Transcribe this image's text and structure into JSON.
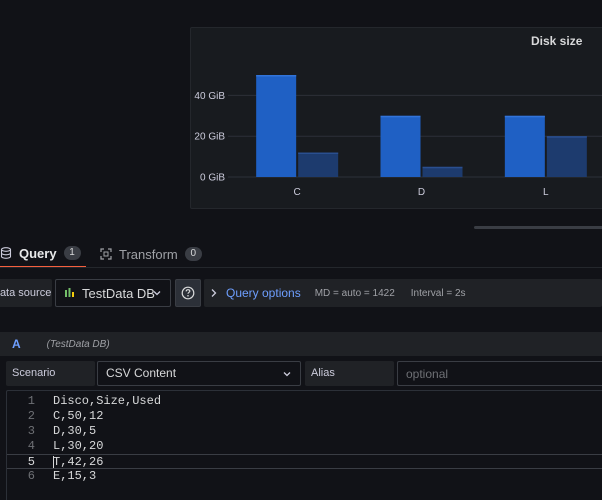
{
  "panel": {
    "title": "Disk size"
  },
  "chart_data": {
    "type": "bar",
    "title": "Disk size",
    "categories": [
      "C",
      "D",
      "L"
    ],
    "series": [
      {
        "values": [
          50,
          30,
          30
        ],
        "color": "#1f60c4"
      },
      {
        "values": [
          12,
          5,
          20
        ],
        "color": "#1d3b6e"
      }
    ],
    "y_ticks": [
      "0 GiB",
      "20 GiB",
      "40 GiB"
    ],
    "y_tick_values": [
      0,
      20,
      40
    ],
    "ylim": [
      0,
      50
    ],
    "grid": true
  },
  "tabs": [
    {
      "label": "Query",
      "count": "1",
      "icon": "database-icon",
      "active": true
    },
    {
      "label": "Transform",
      "count": "0",
      "icon": "transform-icon",
      "active": false
    }
  ],
  "toolbar": {
    "datasource_label": "Data source",
    "datasource_value": "TestData DB",
    "query_options_label": "Query options",
    "md_text": "MD = auto = 1422",
    "interval_text": "Interval = 2s"
  },
  "query": {
    "ref_id": "A",
    "datasource_name": "(TestData DB)",
    "scenario_label": "Scenario",
    "scenario_value": "CSV Content",
    "alias_label": "Alias",
    "alias_placeholder": "optional"
  },
  "editor": {
    "lines": [
      {
        "num": "1",
        "text": "Disco,Size,Used"
      },
      {
        "num": "2",
        "text": "C,50,12"
      },
      {
        "num": "3",
        "text": "D,30,5"
      },
      {
        "num": "4",
        "text": "L,30,20"
      },
      {
        "num": "5",
        "text": "T,42,26"
      },
      {
        "num": "6",
        "text": "E,15,3"
      }
    ],
    "current_line": 4
  },
  "colors": {
    "accent": "#6e9fff",
    "active_tab_underline": "#f55f3e",
    "bar_primary": "#1f60c4",
    "bar_secondary": "#1d3b6e"
  }
}
